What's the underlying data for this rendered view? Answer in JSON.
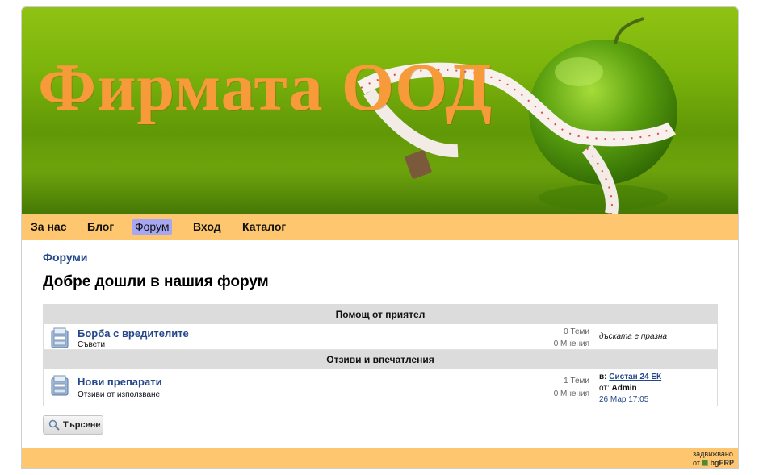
{
  "banner": {
    "title": "Фирмата ООД"
  },
  "nav": {
    "items": [
      {
        "label": "За нас"
      },
      {
        "label": "Блог"
      },
      {
        "label": "Форум"
      },
      {
        "label": "Вход"
      },
      {
        "label": "Каталог"
      }
    ],
    "active_index": 2
  },
  "breadcrumb": {
    "label": "Форуми"
  },
  "main": {
    "title": "Добре дошли в нашия форум",
    "categories": [
      {
        "name": "Помощ от приятел",
        "boards": [
          {
            "name": "Борба с вредителите",
            "desc": "Съвети",
            "topics": "0 Теми",
            "posts": "0 Мнения",
            "last_empty": "дъската е празна"
          }
        ]
      },
      {
        "name": "Отзиви и впечатления",
        "boards": [
          {
            "name": "Нови препарати",
            "desc": "Отзиви от използване",
            "topics": "1 Теми",
            "posts": "0 Мнения",
            "last": {
              "in_label": "в:",
              "topic": "Систан 24 ЕК",
              "by_label": "от:",
              "author": "Admin",
              "date": "26 Мар 17:05"
            }
          }
        ]
      }
    ],
    "search_label": "Търсене"
  },
  "footer": {
    "powered_line1": "задвижвано",
    "powered_by": "от",
    "brand": "bgERP"
  },
  "colors": {
    "nav_bg": "#fec66e",
    "active_nav": "#a6a6f3",
    "link": "#23478a",
    "title_orange": "#f79a3a"
  },
  "icons": [
    "board-icon",
    "search-icon",
    "bgerp-icon"
  ]
}
